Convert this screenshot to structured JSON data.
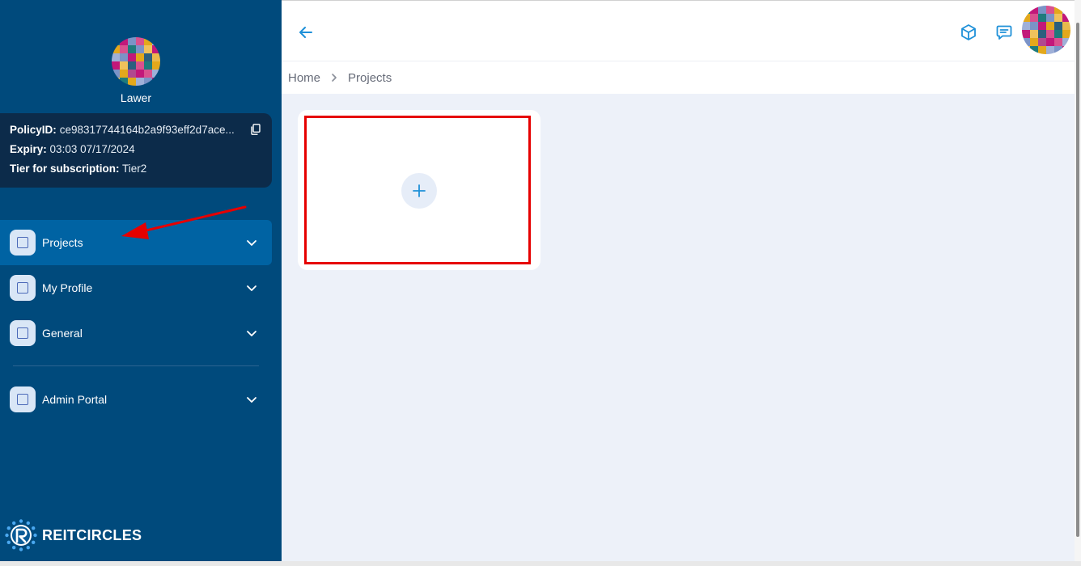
{
  "sidebar": {
    "username": "Lawer",
    "policy": {
      "id_label": "PolicyID:",
      "id_value": "ce98317744164b2a9f93eff2d7ace...",
      "expiry_label": "Expiry:",
      "expiry_value": "03:03 07/17/2024",
      "tier_label": "Tier for subscription:",
      "tier_value": "Tier2"
    },
    "nav": [
      {
        "label": "Projects",
        "active": true
      },
      {
        "label": "My Profile",
        "active": false
      },
      {
        "label": "General",
        "active": false
      },
      {
        "label": "Admin Portal",
        "active": false
      }
    ],
    "brand": "REITCIRCLES"
  },
  "breadcrumb": {
    "home": "Home",
    "current": "Projects"
  },
  "icons": {
    "back": "arrow-left-icon",
    "cube": "cube-icon",
    "chat": "chat-icon",
    "add": "plus-icon",
    "copy": "copy-icon",
    "chevron": "chevron-down-icon"
  },
  "colors": {
    "sidebar_bg": "#004a7c",
    "active_nav": "#0063a3",
    "policy_card": "#0c2b4a",
    "accent": "#1e90d8",
    "content_bg": "#edf1f9",
    "annotation": "#e60000"
  }
}
